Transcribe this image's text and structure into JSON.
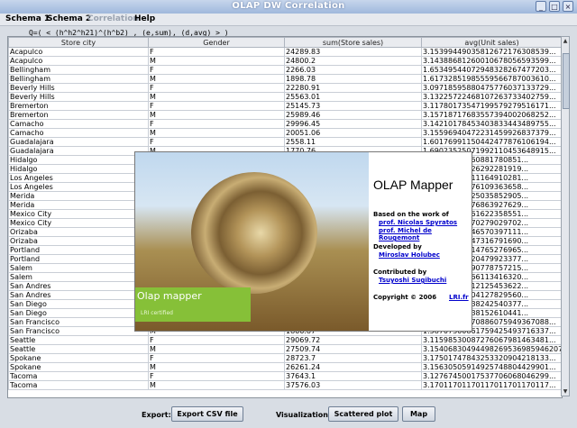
{
  "window": {
    "title": "OLAP DW Correlation"
  },
  "menu": [
    "Schema 1",
    "Schema 2",
    "Correlation",
    "Help"
  ],
  "query": "Q=( < (h^h2^h21)^(h^b2) , (e,sum), (d,avg) > )",
  "table": {
    "headers": [
      "Store city",
      "Gender",
      "sum(Store sales)",
      "avg(Unit sales)"
    ],
    "rows": [
      [
        "Acapulco",
        "F",
        "24289.83",
        "3.15399449035812672176308539..."
      ],
      [
        "Acapulco",
        "M",
        "24800.2",
        "3.14388681260010678056593599..."
      ],
      [
        "Bellingham",
        "F",
        "2266.03",
        "1.65349544072948328267477203..."
      ],
      [
        "Bellingham",
        "M",
        "1898.78",
        "1.61732851985559566787003610..."
      ],
      [
        "Beverly Hills",
        "F",
        "22280.91",
        "3.09718595880475776037133729..."
      ],
      [
        "Beverly Hills",
        "M",
        "25563.01",
        "3.13225722468107263733402759..."
      ],
      [
        "Bremerton",
        "F",
        "25145.73",
        "3.11780173547199579279516171..."
      ],
      [
        "Bremerton",
        "M",
        "25989.46",
        "3.15718717683557394002068252..."
      ],
      [
        "Camacho",
        "F",
        "29996.45",
        "3.14210178453403833443489755..."
      ],
      [
        "Camacho",
        "M",
        "20051.06",
        "3.15596940472231459926837379..."
      ],
      [
        "Guadalajara",
        "F",
        "2558.11",
        "1.60176991150442477876106194..."
      ],
      [
        "Guadalajara",
        "M",
        "1770.76",
        "1.69023525071992110453648915..."
      ],
      [
        "Hidalgo",
        "",
        "",
        "3.16736902960881780851..."
      ],
      [
        "Hidalgo",
        "",
        "",
        "3.15514700326292281919..."
      ],
      [
        "Los Angeles",
        "",
        "",
        "3.15246832811164910281..."
      ],
      [
        "Los Angeles",
        "",
        "",
        "3.13423937576109363658..."
      ],
      [
        "Merida",
        "",
        "",
        "3.16246605125035852905..."
      ],
      [
        "Merida",
        "",
        "",
        "3.16129375476863927629..."
      ],
      [
        "Mexico City",
        "",
        "",
        "3.14601008861622358551..."
      ],
      [
        "Mexico City",
        "",
        "",
        "3.16170702970279029702..."
      ],
      [
        "Orizaba",
        "",
        "",
        "3.15536552346570397111..."
      ],
      [
        "Orizaba",
        "",
        "",
        "3.16839446047316791690..."
      ],
      [
        "Portland",
        "",
        "",
        "3.15275024914765276965..."
      ],
      [
        "Portland",
        "",
        "",
        "3.15360608220479923377..."
      ],
      [
        "Salem",
        "",
        "",
        "3.14633161190778757215..."
      ],
      [
        "Salem",
        "",
        "",
        "3.15464014466113416320..."
      ],
      [
        "San Andres",
        "",
        "",
        "3.16103837812125453622..."
      ],
      [
        "San Andres",
        "",
        "",
        "3.14105071904127829560..."
      ],
      [
        "San Diego",
        "",
        "",
        "3.15669915138242540377..."
      ],
      [
        "San Diego",
        "",
        "",
        "3.15648634538152610441..."
      ],
      [
        "San Francisco",
        "F",
        "2363.15",
        "1.60759493670886075949367088..."
      ],
      [
        "San Francisco",
        "M",
        "1866.87",
        "1.58707360861759425493716337..."
      ],
      [
        "Seattle",
        "F",
        "29069.72",
        "3.11598530087276067981463481..."
      ],
      [
        "Seattle",
        "M",
        "27509.74",
        "3.15406830494498269536985946207..."
      ],
      [
        "Spokane",
        "F",
        "28723.7",
        "3.17501747843253320904218133..."
      ],
      [
        "Spokane",
        "M",
        "26261.24",
        "3.15630505914925748804429901..."
      ],
      [
        "Tacoma",
        "F",
        "37643.1",
        "3.12767450017537706068046299..."
      ],
      [
        "Tacoma",
        "M",
        "37576.03",
        "3.17011701170117011701170117..."
      ]
    ]
  },
  "splash": {
    "title": "OLAP Mapper",
    "based_on": "Based on the work of",
    "author1": "prof. Nicolas Spyratos",
    "author2": "prof. Michel de Rougemont",
    "developed_by": "Developed by",
    "developer": "Miroslav Holubec",
    "contributed_by": "Contributed by",
    "contributor": "Tsuyoshi Sugibuchi",
    "copyright": "Copyright © 2006",
    "lab": "LRI.fr",
    "banner": "Olap mapper",
    "banner_sub": "LRI certified"
  },
  "bottom": {
    "export_label": "Export:",
    "export_button": "Export CSV file",
    "visualization_label": "Visualization:",
    "scatter_button": "Scattered plot",
    "map_button": "Map"
  }
}
